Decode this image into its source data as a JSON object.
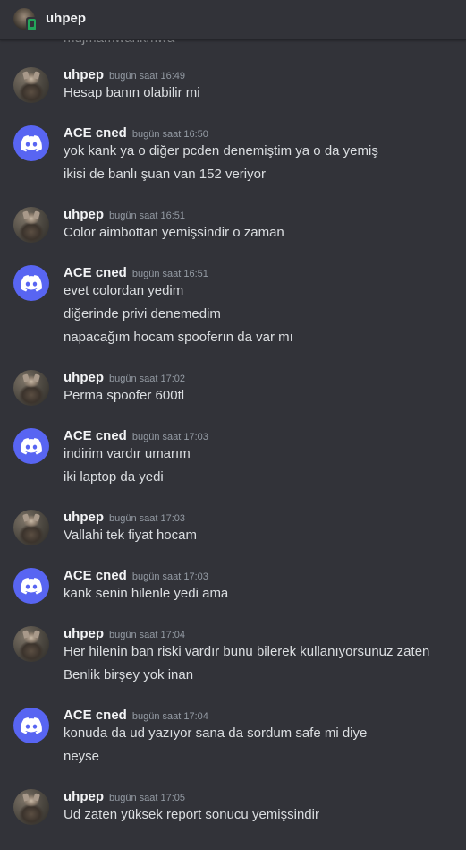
{
  "channel": {
    "name": "uhpep",
    "cutoff_text": "mujmamwankmwa"
  },
  "colors": {
    "background": "#323339",
    "username": "#f2f3f5",
    "timestamp": "#949ba4",
    "message_text": "#dbdee1",
    "bot_avatar": "#5865f2",
    "mobile_status": "#23a55a"
  },
  "messages": [
    {
      "author": "uhpep",
      "avatar": "user-avatar",
      "time": "bugün saat 16:49",
      "lines": [
        "Hesap banın olabilir mi"
      ]
    },
    {
      "author": "ACE cned",
      "avatar": "discord-logo-icon",
      "time": "bugün saat 16:50",
      "lines": [
        "yok kank ya o diğer pcden denemiştim ya o da yemiş",
        "ikisi de banlı şuan van 152 veriyor"
      ]
    },
    {
      "author": "uhpep",
      "avatar": "user-avatar",
      "time": "bugün saat 16:51",
      "lines": [
        "Color aimbottan yemişsindir o zaman"
      ]
    },
    {
      "author": "ACE cned",
      "avatar": "discord-logo-icon",
      "time": "bugün saat 16:51",
      "lines": [
        "evet colordan yedim",
        "diğerinde privi denemedim",
        "napacağım hocam spooferın da var mı"
      ]
    },
    {
      "author": "uhpep",
      "avatar": "user-avatar",
      "time": "bugün saat 17:02",
      "lines": [
        "Perma spoofer 600tl"
      ]
    },
    {
      "author": "ACE cned",
      "avatar": "discord-logo-icon",
      "time": "bugün saat 17:03",
      "lines": [
        "indirim vardır umarım",
        "iki laptop da yedi"
      ]
    },
    {
      "author": "uhpep",
      "avatar": "user-avatar",
      "time": "bugün saat 17:03",
      "lines": [
        "Vallahi tek fiyat hocam"
      ]
    },
    {
      "author": "ACE cned",
      "avatar": "discord-logo-icon",
      "time": "bugün saat 17:03",
      "lines": [
        "kank senin hilenle yedi ama"
      ]
    },
    {
      "author": "uhpep",
      "avatar": "user-avatar",
      "time": "bugün saat 17:04",
      "lines": [
        "Her hilenin ban riski vardır bunu bilerek kullanıyorsunuz zaten",
        "Benlik birşey yok inan"
      ]
    },
    {
      "author": "ACE cned",
      "avatar": "discord-logo-icon",
      "time": "bugün saat 17:04",
      "lines": [
        "konuda da ud yazıyor sana da sordum safe mi diye",
        "neyse"
      ]
    },
    {
      "author": "uhpep",
      "avatar": "user-avatar",
      "time": "bugün saat 17:05",
      "lines": [
        "Ud zaten yüksek report sonucu yemişsindir"
      ]
    }
  ]
}
